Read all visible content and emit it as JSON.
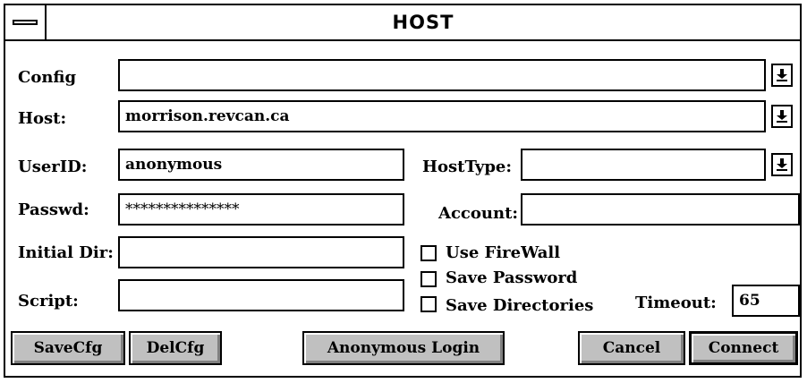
{
  "window": {
    "title": "HOST"
  },
  "labels": {
    "config": "Config",
    "host": "Host:",
    "userid": "UserID:",
    "passwd": "Passwd:",
    "initial_dir": "Initial Dir:",
    "script": "Script:",
    "hosttype": "HostType:",
    "account": "Account:",
    "timeout": "Timeout:"
  },
  "fields": {
    "config": "",
    "host": "morrison.revcan.ca",
    "userid": "anonymous",
    "passwd": "***************",
    "initial_dir": "",
    "script": "",
    "hosttype": "",
    "account": "",
    "timeout": "65"
  },
  "checkboxes": {
    "use_firewall": {
      "label": "Use FireWall",
      "checked": false
    },
    "save_password": {
      "label": "Save Password",
      "checked": false
    },
    "save_directories": {
      "label": "Save Directories",
      "checked": false
    }
  },
  "buttons": {
    "savecfg": "SaveCfg",
    "delcfg": "DelCfg",
    "anonymous_login": "Anonymous Login",
    "cancel": "Cancel",
    "connect": "Connect"
  }
}
